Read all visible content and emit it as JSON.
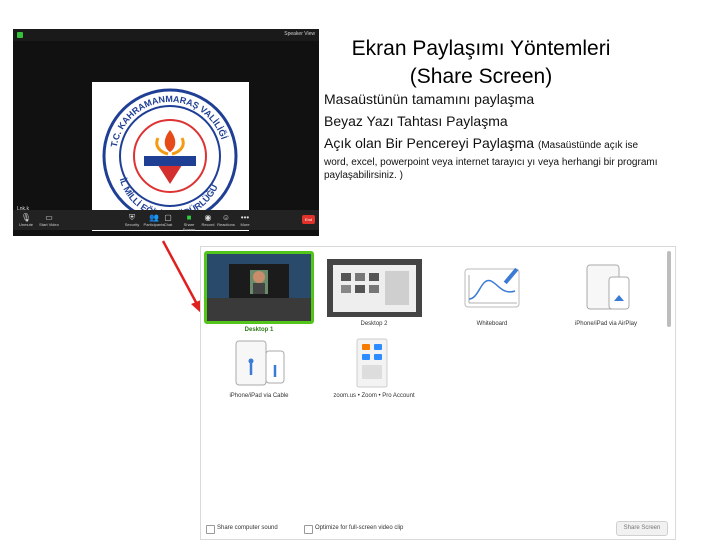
{
  "zoom_window": {
    "view_label": "Speaker View",
    "participant_name": "Lnk.k",
    "toolbar": [
      {
        "label": "Unmute",
        "icon": "mic-icon"
      },
      {
        "label": "Start Video",
        "icon": "camera-icon"
      },
      {
        "label": "Security",
        "icon": "shield-icon"
      },
      {
        "label": "Participants",
        "icon": "participants-icon"
      },
      {
        "label": "Chat",
        "icon": "chat-icon"
      },
      {
        "label": "Share Screen",
        "icon": "share-screen-icon"
      },
      {
        "label": "Record",
        "icon": "record-icon"
      },
      {
        "label": "Reactions",
        "icon": "reactions-icon"
      },
      {
        "label": "More",
        "icon": "more-icon"
      }
    ],
    "end_label": "End",
    "logo_text_top": "T.C. KAHRAMANMARAŞ VALİLİĞİ",
    "logo_text_bottom": "İL MİLLİ EĞİTİM MÜDÜRLÜĞÜ"
  },
  "slide": {
    "title_line1": "Ekran Paylaşımı Yöntemleri",
    "title_line2": "(Share Screen)",
    "item1": "Masaüstünün tamamını paylaşma",
    "item2": "Beyaz Yazı Tahtası Paylaşma",
    "item3": "Açık olan Bir Pencereyi Paylaşma",
    "item3_note": "(Masaüstünde açık ise",
    "note": "word, excel, powerpoint veya internet tarayıcı yı veya herhangi bir programı paylaşabilirsiniz. )"
  },
  "share_dialog": {
    "options": [
      {
        "label": "Desktop 1",
        "selected": true
      },
      {
        "label": "Desktop 2",
        "selected": false
      },
      {
        "label": "Whiteboard",
        "selected": false
      },
      {
        "label": "iPhone/iPad via AirPlay",
        "selected": false
      },
      {
        "label": "iPhone/iPad via Cable",
        "selected": false
      },
      {
        "label": "zoom.us • Zoom • Pro Account",
        "selected": false
      }
    ],
    "share_sound_label": "Share computer sound",
    "optimize_label": "Optimize for full-screen video clip",
    "share_button": "Share Screen"
  },
  "colors": {
    "accent_green": "#52c41a",
    "arrow_red": "#e02020",
    "end_red": "#e0322b"
  }
}
